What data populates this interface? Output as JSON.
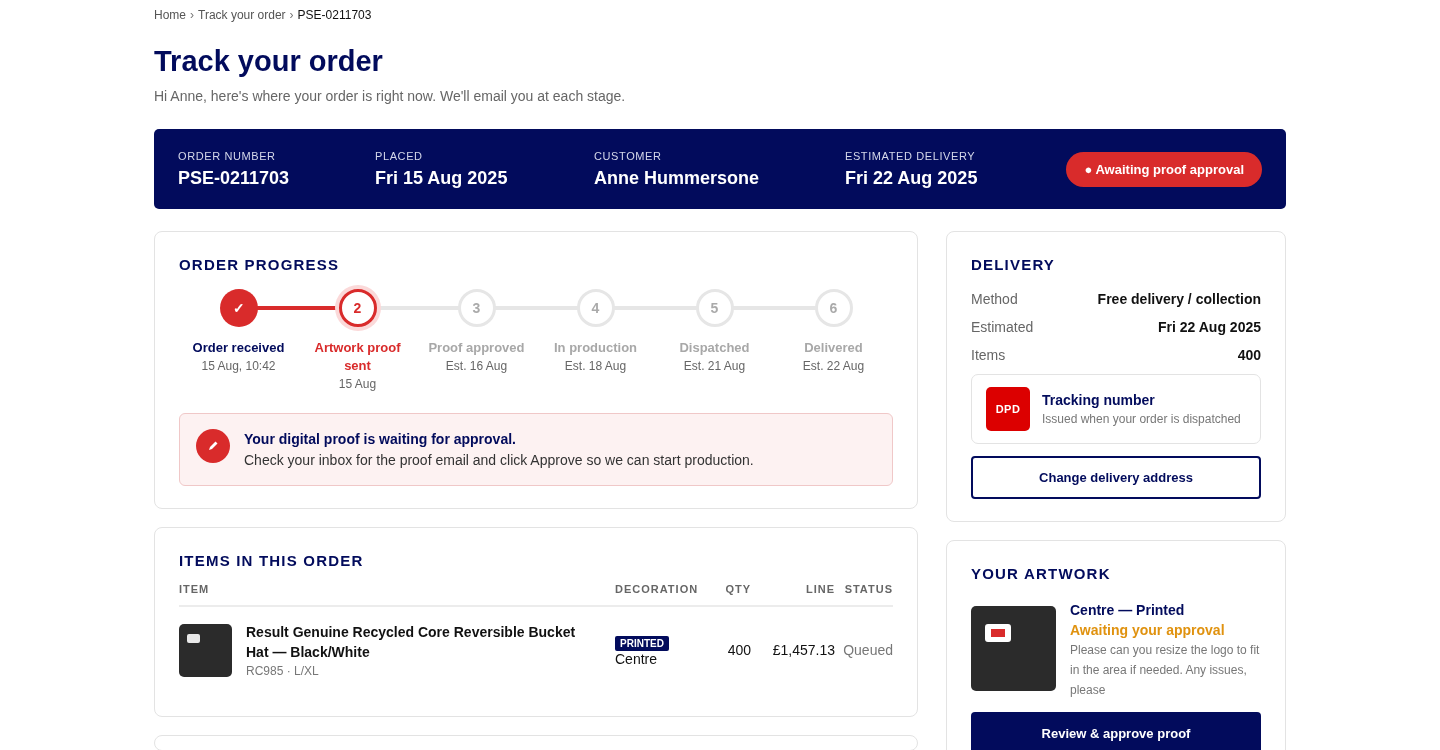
{
  "breadcrumb": {
    "separator": "›",
    "items": [
      {
        "label": "Home",
        "current": false
      },
      {
        "label": "Track your order",
        "current": false
      },
      {
        "label": "PSE-0211703",
        "current": true
      }
    ]
  },
  "title": "Track your order",
  "subtitle": "Hi Anne, here's where your order is right now. We'll email you at each stage.",
  "summary": {
    "fields": [
      {
        "label": "ORDER NUMBER",
        "value": "PSE-0211703"
      },
      {
        "label": "PLACED",
        "value": "Fri 15 Aug 2025"
      },
      {
        "label": "CUSTOMER",
        "value": "Anne Hummersone"
      },
      {
        "label": "ESTIMATED DELIVERY",
        "value": "Fri 22 Aug 2025"
      }
    ],
    "status_badge": "● Awaiting proof approval"
  },
  "progress": {
    "heading": "ORDER PROGRESS",
    "steps": [
      {
        "marker": "✓",
        "label": "Order received",
        "date": "15 Aug, 10:42",
        "completed": true,
        "selected": false
      },
      {
        "marker": "2",
        "label": "Artwork proof sent",
        "date": "15 Aug",
        "completed": false,
        "selected": true
      },
      {
        "marker": "3",
        "label": "Proof approved",
        "date": "Est. 16 Aug",
        "completed": false,
        "selected": false
      },
      {
        "marker": "4",
        "label": "In production",
        "date": "Est. 18 Aug",
        "completed": false,
        "selected": false
      },
      {
        "marker": "5",
        "label": "Dispatched",
        "date": "Est. 21 Aug",
        "completed": false,
        "selected": false
      },
      {
        "marker": "6",
        "label": "Delivered",
        "date": "Est. 22 Aug",
        "completed": false,
        "selected": false
      }
    ],
    "alert": {
      "title": "Your digital proof is waiting for approval.",
      "text": "Check your inbox for the proof email and click Approve so we can start production."
    }
  },
  "items": {
    "heading": "ITEMS IN THIS ORDER",
    "columns": [
      "ITEM",
      "DECORATION",
      "QTY",
      "LINE",
      "STATUS"
    ],
    "rows": [
      {
        "name": "Result Genuine Recycled Core Reversible Bucket Hat — Black/White",
        "meta": "RC985 · L/XL",
        "decoration_tag": "PRINTED",
        "decoration": "Centre",
        "qty": "400",
        "line": "£1,457.13",
        "status": "Queued"
      }
    ]
  },
  "delivery": {
    "heading": "DELIVERY",
    "rows": [
      {
        "label": "Method",
        "value": "Free delivery / collection"
      },
      {
        "label": "Estimated",
        "value": "Fri 22 Aug 2025"
      },
      {
        "label": "Items",
        "value": "400"
      }
    ],
    "carrier_logo": "DPD",
    "tracking_title": "Tracking number",
    "tracking_note": "Issued when your order is dispatched",
    "button": "Change delivery address"
  },
  "artwork": {
    "heading": "YOUR ARTWORK",
    "title": "Centre — Printed",
    "status": "Awaiting your approval",
    "note": "Please can you resize the logo to fit in the area if needed. Any issues, please",
    "button": "Review & approve proof"
  }
}
